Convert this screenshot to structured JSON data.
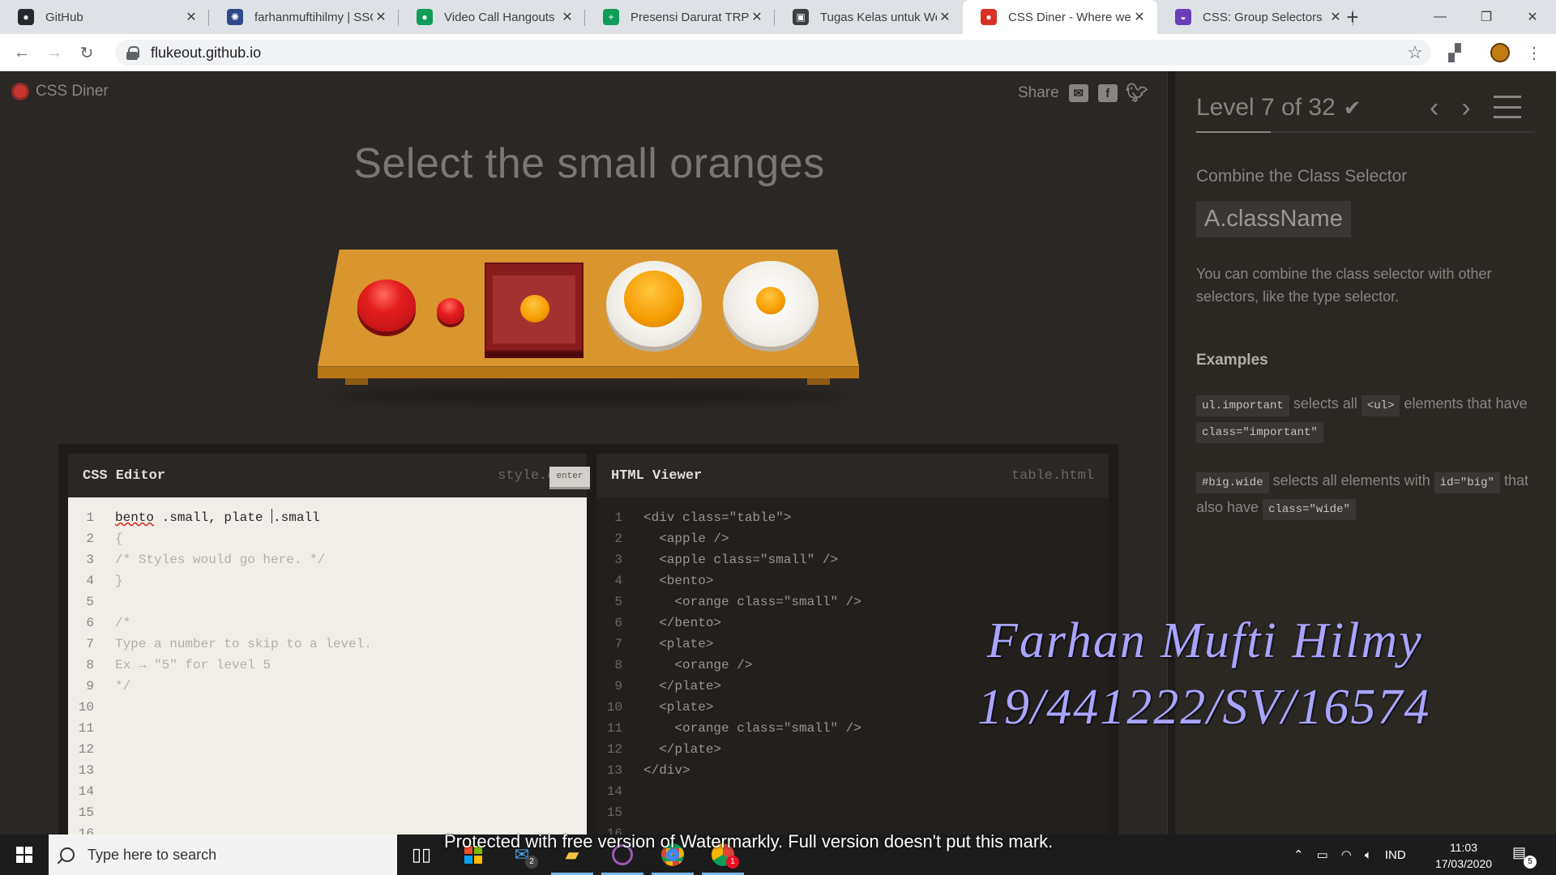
{
  "browser": {
    "tabs": [
      {
        "title": "GitHub",
        "color": "#24292e",
        "glyph": "●"
      },
      {
        "title": "farhanmuftihilmy | SSO",
        "color": "#2f4a8c",
        "glyph": "✺"
      },
      {
        "title": "Video Call Hangouts",
        "color": "#0f9d58",
        "glyph": "●"
      },
      {
        "title": "Presensi Darurat TRPL I",
        "color": "#0f9d58",
        "glyph": "+"
      },
      {
        "title": "Tugas Kelas untuk Web",
        "color": "#3c4043",
        "glyph": "▣"
      },
      {
        "title": "CSS Diner - Where we",
        "color": "#d93025",
        "glyph": "●"
      },
      {
        "title": "CSS: Group Selectors",
        "color": "#6a3db8",
        "glyph": "◒"
      }
    ],
    "active_tab": 5,
    "new_tab": "+",
    "url": "flukeout.github.io",
    "window_controls": {
      "minimize": "—",
      "maximize": "❐",
      "close": "✕"
    }
  },
  "game": {
    "logo": "CSS Diner",
    "share_label": "Share",
    "share_icons": [
      "email-icon",
      "facebook-icon",
      "twitter-icon"
    ],
    "order": "Select the small oranges",
    "css_editor": {
      "title": "CSS Editor",
      "file": "style.css",
      "input": {
        "part1": "bento",
        "part2": " .small, plate ",
        "part3": ".small"
      },
      "lines": [
        "",
        "{",
        "/* Styles would go here. */",
        "}",
        "",
        "/*",
        "Type a number to skip to a level.",
        "Ex → \"5\" for level 5",
        "*/",
        "",
        "",
        "",
        "",
        "",
        "",
        ""
      ],
      "enter_label": "enter"
    },
    "html_viewer": {
      "title": "HTML Viewer",
      "file": "table.html",
      "lines": [
        "<div class=\"table\">",
        "  <apple />",
        "  <apple class=\"small\" />",
        "  <bento>",
        "    <orange class=\"small\" />",
        "  </bento>",
        "  <plate>",
        "    <orange />",
        "  </plate>",
        "  <plate>",
        "    <orange class=\"small\" />",
        "  </plate>",
        "</div>",
        "",
        "",
        ""
      ]
    },
    "line_numbers": [
      "1",
      "2",
      "3",
      "4",
      "5",
      "6",
      "7",
      "8",
      "9",
      "10",
      "11",
      "12",
      "13",
      "14",
      "15",
      "16"
    ]
  },
  "sidebar": {
    "level": "Level 7 of 32",
    "check": "✔",
    "progress": 0.219,
    "selector_name": "Combine the Class Selector",
    "syntax": "A.className",
    "description": "You can combine the class selector with other selectors, like the type selector.",
    "examples_title": "Examples",
    "examples": [
      {
        "code1": "ul.important",
        "t1": " selects all ",
        "code2": "<ul>",
        "t2": " elements that have ",
        "code3": "class=\"important\""
      },
      {
        "code1": "#big.wide",
        "t1": " selects all elements with ",
        "code2": "id=\"big\"",
        "t2": " that also have ",
        "code3": "class=\"wide\""
      }
    ]
  },
  "overlay": {
    "name": "Farhan Mufti Hilmy",
    "id": "19/441222/SV/16574",
    "watermarkly": "Protected with free version of Watermarkly. Full version doesn't put this mark."
  },
  "taskbar": {
    "search_placeholder": "Type here to search",
    "mail_badge": "2",
    "chrome_badge": "1",
    "language": "IND",
    "time": "11:03",
    "date": "17/03/2020",
    "notif_badge": "5"
  }
}
